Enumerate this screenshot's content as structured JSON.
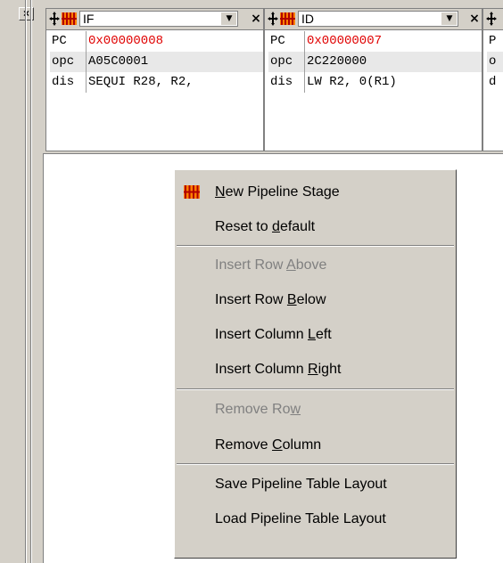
{
  "frame": {
    "close_glyph": "×"
  },
  "stages": [
    {
      "name": "IF",
      "rows": [
        {
          "key": "PC",
          "value": "0x00000008",
          "highlight": true
        },
        {
          "key": "opc",
          "value": "A05C0001",
          "highlight": false
        },
        {
          "key": "dis",
          "value": "SEQUI R28, R2,",
          "highlight": false
        }
      ]
    },
    {
      "name": "ID",
      "rows": [
        {
          "key": "PC",
          "value": "0x00000007",
          "highlight": true
        },
        {
          "key": "opc",
          "value": "2C220000",
          "highlight": false
        },
        {
          "key": "dis",
          "value": "LW R2, 0(R1)",
          "highlight": false
        }
      ]
    },
    {
      "name": "",
      "rows": [
        {
          "key": "P",
          "value": "",
          "highlight": false
        },
        {
          "key": "o",
          "value": "",
          "highlight": false
        },
        {
          "key": "d",
          "value": "",
          "highlight": false
        }
      ]
    }
  ],
  "stage_controls": {
    "dropdown_glyph": "▼",
    "close_glyph": "×"
  },
  "menu": {
    "items": [
      {
        "pre": "",
        "key": "N",
        "post": "ew Pipeline Stage",
        "enabled": true,
        "icon": "pipeline-stage-icon"
      },
      {
        "pre": "Reset to ",
        "key": "d",
        "post": "efault",
        "enabled": true
      },
      {
        "pre": "Insert Row ",
        "key": "A",
        "post": "bove",
        "enabled": false
      },
      {
        "pre": "Insert Row ",
        "key": "B",
        "post": "elow",
        "enabled": true
      },
      {
        "pre": "Insert Column ",
        "key": "L",
        "post": "eft",
        "enabled": true
      },
      {
        "pre": "Insert Column ",
        "key": "R",
        "post": "ight",
        "enabled": true
      },
      {
        "pre": "Remove Ro",
        "key": "w",
        "post": "",
        "enabled": false
      },
      {
        "pre": "Remove ",
        "key": "C",
        "post": "olumn",
        "enabled": true
      },
      {
        "pre": "Save Pipeline Table Layout",
        "key": "",
        "post": "",
        "enabled": true
      },
      {
        "pre": "Load Pipeline Table Layout",
        "key": "",
        "post": "",
        "enabled": true
      }
    ]
  },
  "colors": {
    "chrome": "#d4d0c8",
    "accent_red": "#e00000",
    "icon_orange": "#ff8000",
    "icon_darkred": "#b00000"
  }
}
